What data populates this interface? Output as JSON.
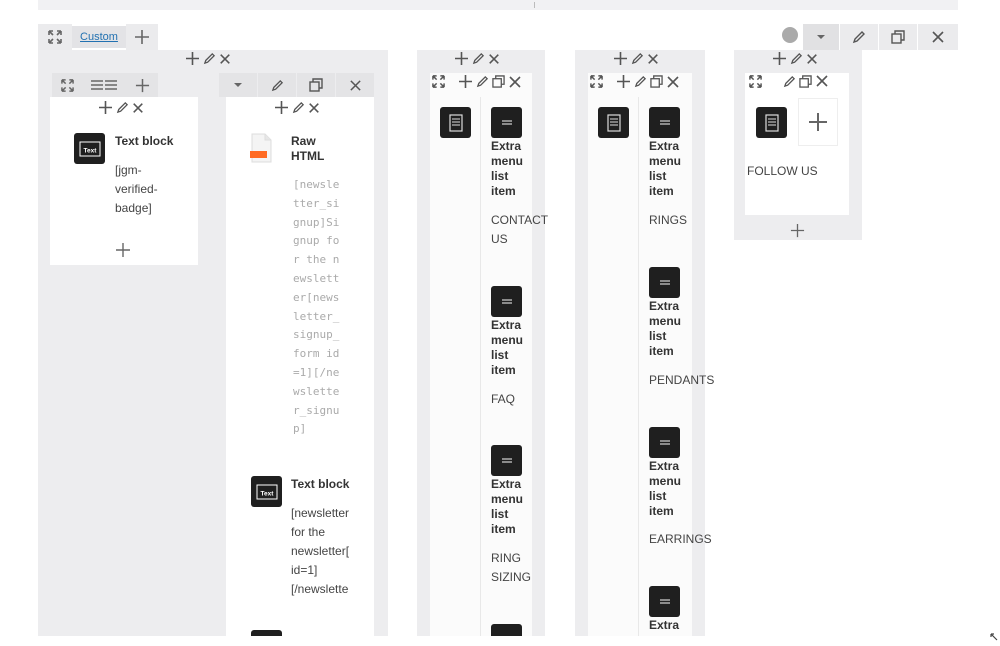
{
  "row": {
    "tab_label": "Custom",
    "icons": [
      "expand-icon",
      "add-icon",
      "circle-icon",
      "dropdown-icon",
      "pencil-icon",
      "clone-icon",
      "close-icon"
    ]
  },
  "column1": {
    "text_block": {
      "title": "Text block",
      "content": "[jgm-\nverified-\nbadge]"
    }
  },
  "column2": {
    "raw_html": {
      "title": "Raw\nHTML",
      "content": "[newsle\ntter_si\ngnup]Si\ngnup fo\nr the n\newslett\ner[news\nletter_\nsignup_\nform id\n=1][/ne\nwslette\nr_signu\np]"
    },
    "text_block": {
      "title": "Text block",
      "content": "[newsletter\nfor the\nnewsletter[\nid=1]\n[/newslette"
    }
  },
  "column3": {
    "items": [
      {
        "title": "Extra\nmenu\nlist\nitem",
        "text": "CONTACT\nUS"
      },
      {
        "title": "Extra\nmenu\nlist\nitem",
        "text": "FAQ"
      },
      {
        "title": "Extra\nmenu\nlist\nitem",
        "text": "RING\nSIZING"
      }
    ]
  },
  "column4": {
    "items": [
      {
        "title": "Extra\nmenu\nlist\nitem",
        "text": "RINGS"
      },
      {
        "title": "Extra\nmenu\nlist\nitem",
        "text": "PENDANTS"
      },
      {
        "title": "Extra\nmenu\nlist\nitem",
        "text": "EARRINGS"
      },
      {
        "title": "Extra",
        "text": ""
      }
    ]
  },
  "column5": {
    "text": "FOLLOW US"
  }
}
